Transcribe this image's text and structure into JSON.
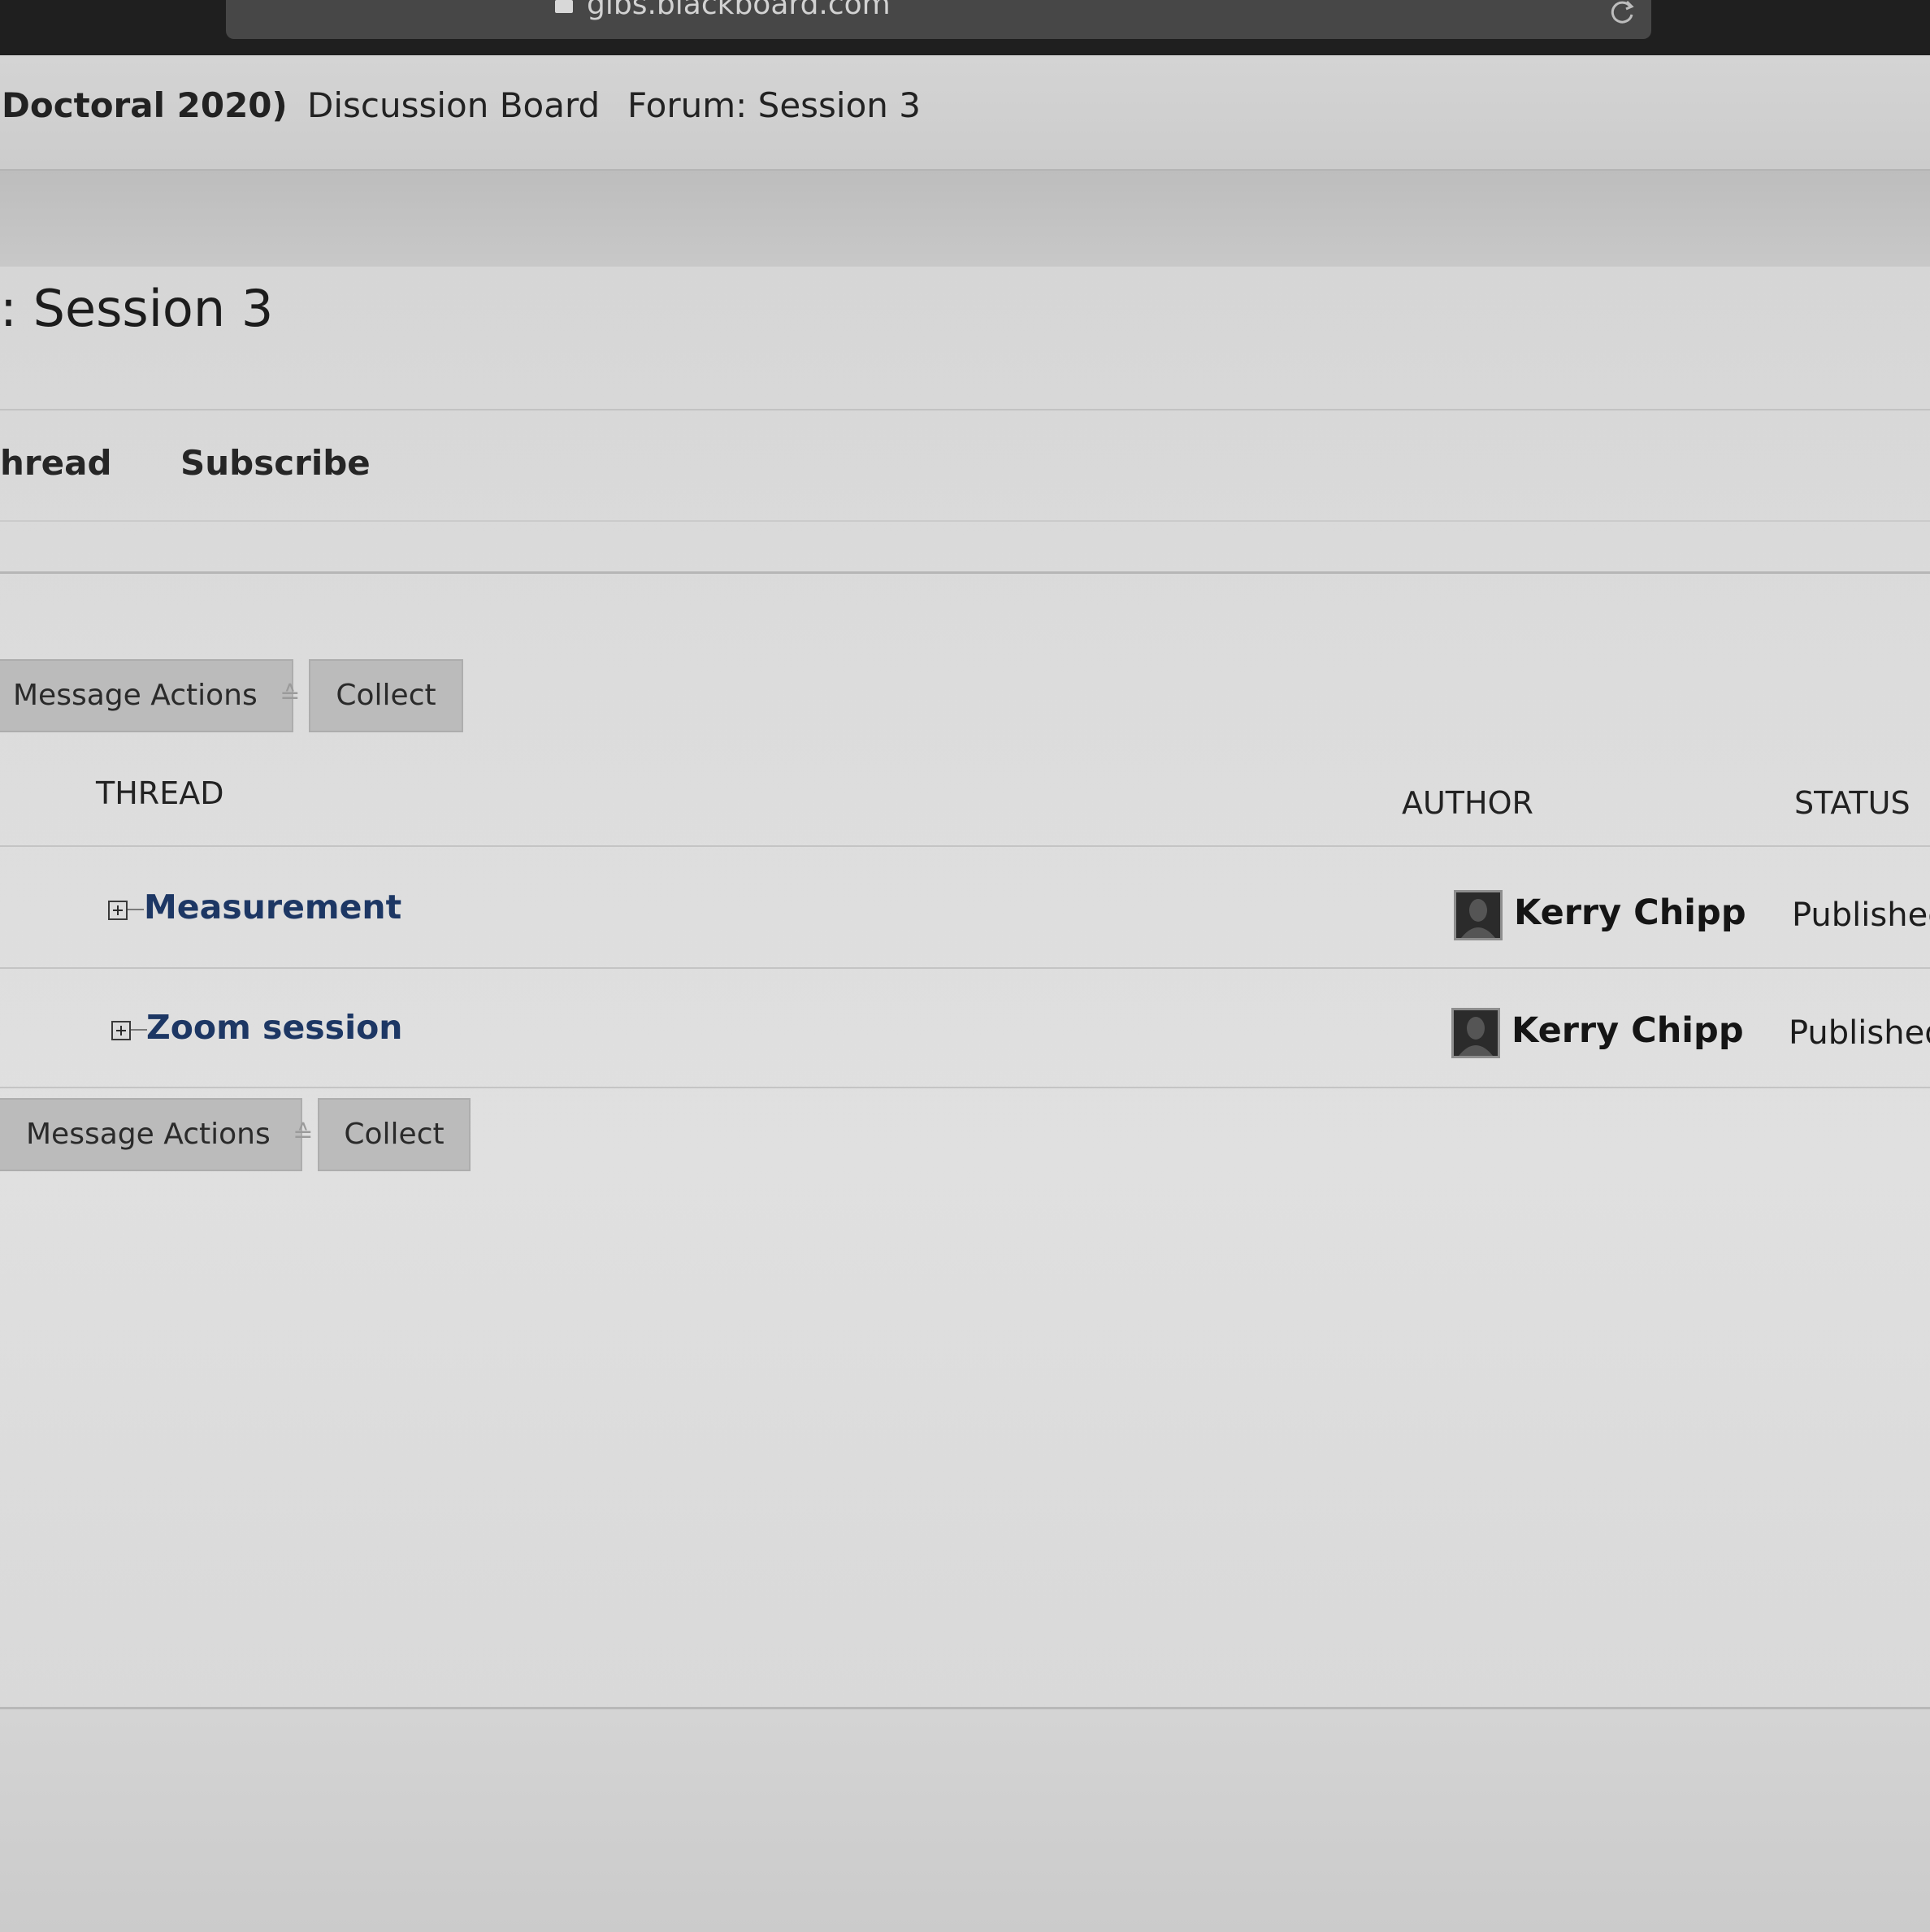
{
  "browser": {
    "url": "gibs.blackboard.com"
  },
  "breadcrumb": {
    "course": "Doctoral 2020)",
    "board": "Discussion Board",
    "forum": "Forum: Session 3"
  },
  "page": {
    "title": ": Session 3"
  },
  "actions": {
    "create_thread": "hread",
    "subscribe": "Subscribe"
  },
  "toolbar": {
    "message_actions": "Message Actions",
    "collect": "Collect"
  },
  "table": {
    "columns": {
      "thread": "THREAD",
      "author": "AUTHOR",
      "status": "STATUS"
    },
    "rows": [
      {
        "thread": "Measurement",
        "author": "Kerry Chipp",
        "status": "Publishec"
      },
      {
        "thread": "Zoom session",
        "author": "Kerry Chipp",
        "status": "Published"
      }
    ]
  },
  "colors": {
    "thread_link": "#1d3764",
    "button_bg": "#bbbbbb",
    "browser_chrome": "#1f1f1f"
  },
  "icons": {
    "lock": "lock-icon",
    "reload": "reload-icon",
    "expand": "expand-icon",
    "chevron": "chevron-down-icon",
    "avatar": "avatar-icon"
  }
}
